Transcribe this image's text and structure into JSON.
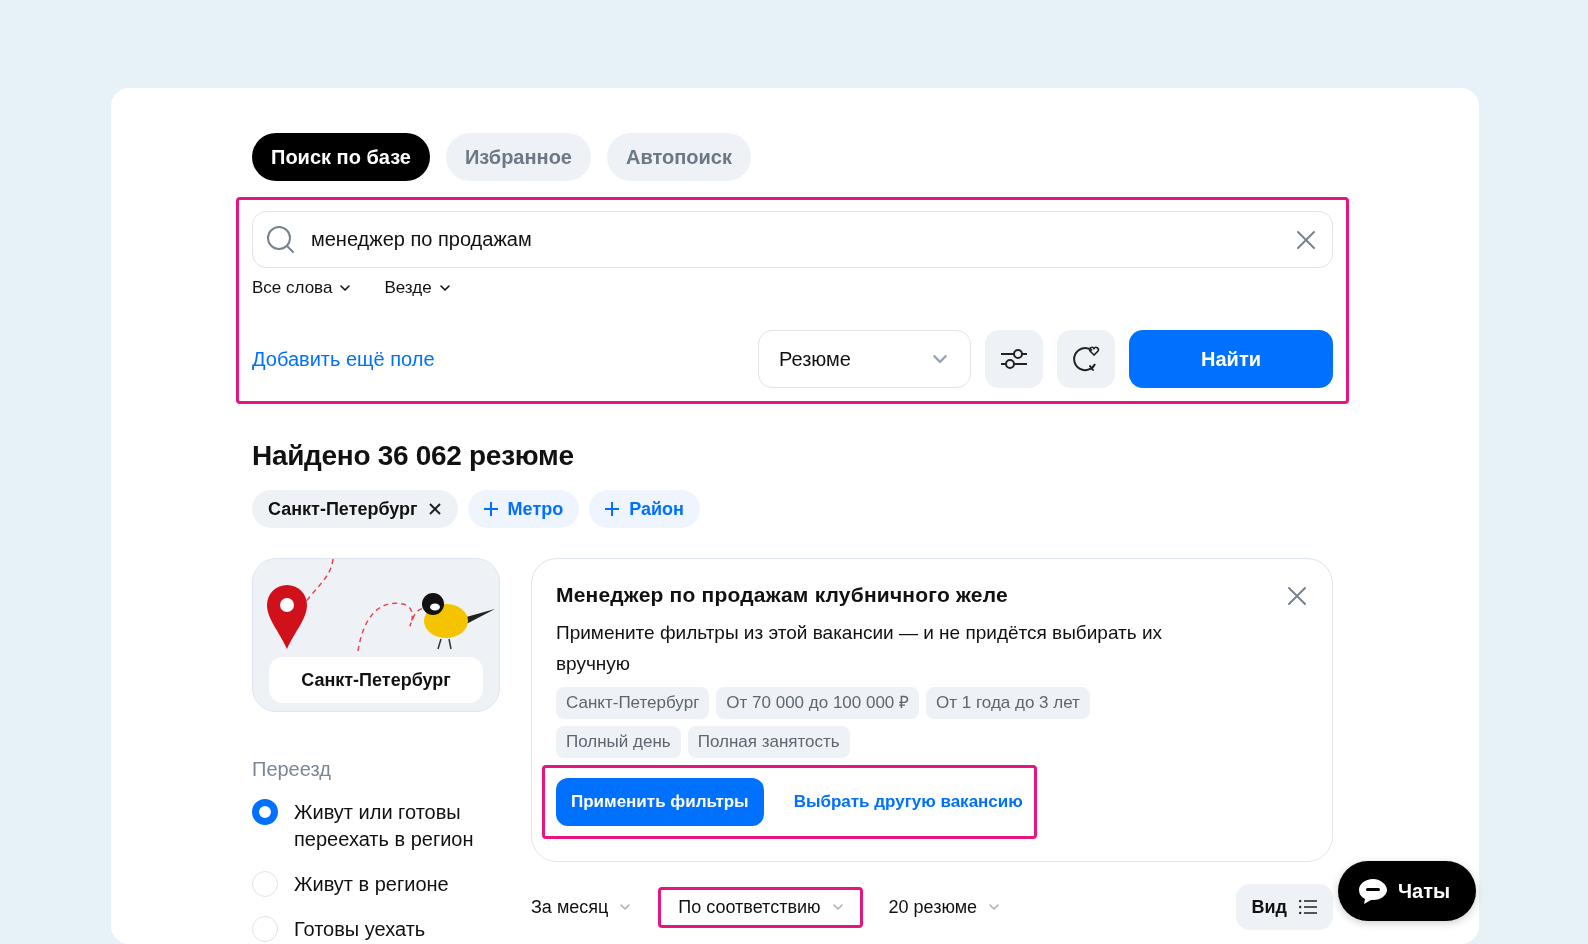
{
  "tabs": [
    {
      "label": "Поиск по базе",
      "selected": true
    },
    {
      "label": "Избранное",
      "selected": false
    },
    {
      "label": "Автопоиск",
      "selected": false
    }
  ],
  "search": {
    "highlighted": true,
    "value": "менеджер по продажам",
    "word_mode": "Все слова",
    "scope": "Везде",
    "add_field_link": "Добавить ещё поле",
    "type_select": "Резюме",
    "submit": "Найти"
  },
  "results": {
    "title": "Найдено 36 062 резюме",
    "chips": [
      {
        "kind": "selected",
        "label": "Санкт-Петербург"
      },
      {
        "kind": "add",
        "label": "Метро"
      },
      {
        "kind": "add",
        "label": "Район"
      }
    ]
  },
  "city_card": {
    "city": "Санкт-Петербург"
  },
  "relocation": {
    "title": "Переезд",
    "options": [
      {
        "label": "Живут или готовы переехать в регион",
        "selected": true
      },
      {
        "label": "Живут в регионе",
        "selected": false
      },
      {
        "label": "Готовы уехать",
        "selected": false
      }
    ]
  },
  "vacancy_card": {
    "title": "Менеджер по продажам клубничного желе",
    "description": "Примените фильтры из этой вакансии — и не придётся выбирать их вручную",
    "tags": [
      "Санкт-Петербург",
      "От 70 000 до 100 000 ₽",
      "От 1 года до 3 лет",
      "Полный день",
      "Полная занятость"
    ],
    "actions_highlighted": true,
    "apply_button": "Применить фильтры",
    "other_link": "Выбрать другую вакансию"
  },
  "sort_bar": {
    "items": [
      {
        "label": "За месяц",
        "highlighted": false
      },
      {
        "label": "По соответствию",
        "highlighted": true
      },
      {
        "label": "20 резюме",
        "highlighted": false
      }
    ],
    "view_button": "Вид"
  },
  "chat_button": "Чаты"
}
